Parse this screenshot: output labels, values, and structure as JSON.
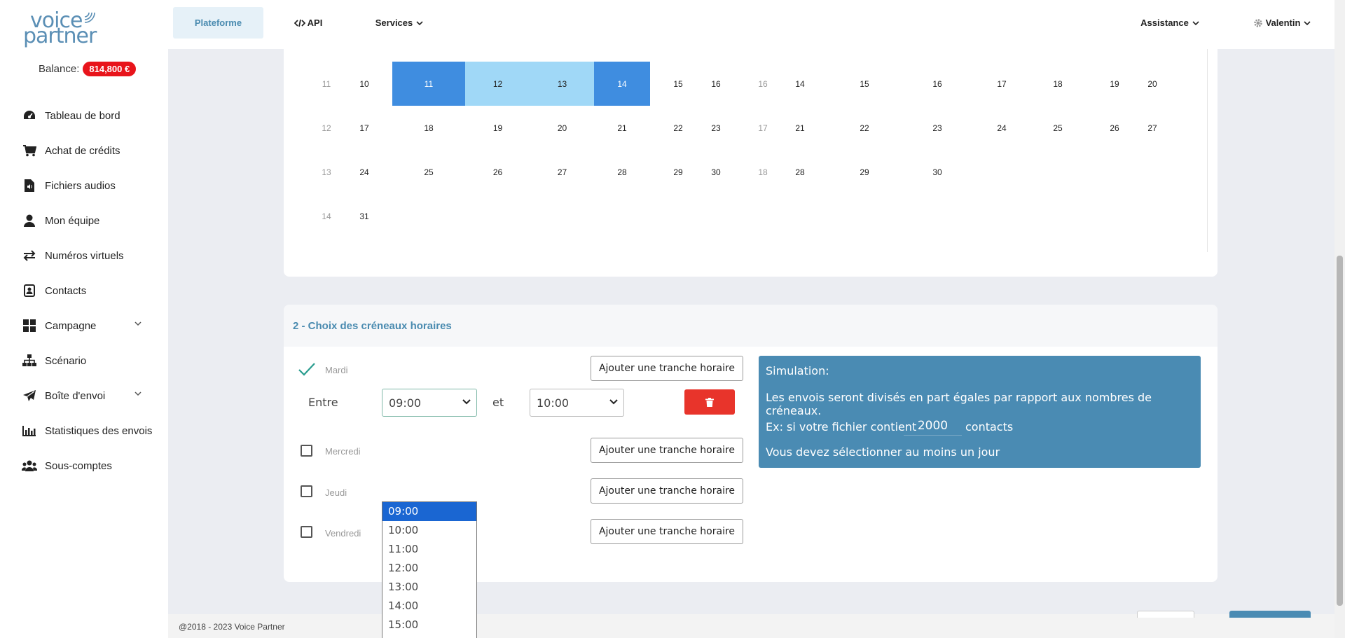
{
  "brand": {
    "line1": "voice",
    "line2": "partner"
  },
  "balance": {
    "label": "Balance:",
    "amount": "814,800 €"
  },
  "sidebar": {
    "items": [
      {
        "label": "Tableau de bord",
        "icon": "dashboard-icon"
      },
      {
        "label": "Achat de crédits",
        "icon": "cart-icon"
      },
      {
        "label": "Fichiers audios",
        "icon": "audio-file-icon"
      },
      {
        "label": "Mon équipe",
        "icon": "user-icon"
      },
      {
        "label": "Numéros virtuels",
        "icon": "exchange-icon"
      },
      {
        "label": "Contacts",
        "icon": "contact-book-icon"
      },
      {
        "label": "Campagne",
        "icon": "grid-icon"
      },
      {
        "label": "Scénario",
        "icon": "sitemap-icon"
      },
      {
        "label": "Boîte d'envoi",
        "icon": "paper-plane-icon"
      },
      {
        "label": "Statistiques des envois",
        "icon": "bar-chart-icon"
      },
      {
        "label": "Sous-comptes",
        "icon": "users-icon"
      }
    ]
  },
  "topbar": {
    "plateforme": "Plateforme",
    "api": "API",
    "services": "Services",
    "assistance": "Assistance",
    "user": "Valentin"
  },
  "calendar": {
    "left_weeks": [
      {
        "week": "11",
        "days": [
          "10",
          "11",
          "12",
          "13",
          "14",
          "15",
          "16"
        ]
      },
      {
        "week": "12",
        "days": [
          "17",
          "18",
          "19",
          "20",
          "21",
          "22",
          "23"
        ]
      },
      {
        "week": "13",
        "days": [
          "24",
          "25",
          "26",
          "27",
          "28",
          "29",
          "30"
        ]
      },
      {
        "week": "14",
        "days": [
          "31"
        ]
      }
    ],
    "right_weeks": [
      {
        "week": "16",
        "days": [
          "14",
          "15",
          "16",
          "17",
          "18",
          "19",
          "20"
        ]
      },
      {
        "week": "17",
        "days": [
          "21",
          "22",
          "23",
          "24",
          "25",
          "26",
          "27"
        ]
      },
      {
        "week": "18",
        "days": [
          "28",
          "29",
          "30"
        ]
      }
    ]
  },
  "slots": {
    "title": "2 - Choix des créneaux horaires",
    "days": [
      {
        "label": "Mardi",
        "checked": true
      },
      {
        "label": "Mercredi",
        "checked": false
      },
      {
        "label": "Jeudi",
        "checked": false
      },
      {
        "label": "Vendredi",
        "checked": false
      }
    ],
    "add_label": "Ajouter une tranche horaire",
    "between_label": "Entre",
    "and_label": "et",
    "from_value": "09:00",
    "to_value": "10:00"
  },
  "simulation": {
    "title": "Simulation:",
    "line1": "Les envois seront divisés en part égales par rapport aux nombres de créneaux.",
    "line2_prefix": "Ex: si votre fichier contient",
    "count": "2000",
    "line2_suffix": "contacts",
    "line3": "Vous devez sélectionner au moins un jour"
  },
  "dropdown": {
    "options": [
      "09:00",
      "10:00",
      "11:00",
      "12:00",
      "13:00",
      "14:00",
      "15:00"
    ],
    "selected": "09:00"
  },
  "footer": {
    "copyright": "@2018 - 2023 Voice Partner"
  }
}
